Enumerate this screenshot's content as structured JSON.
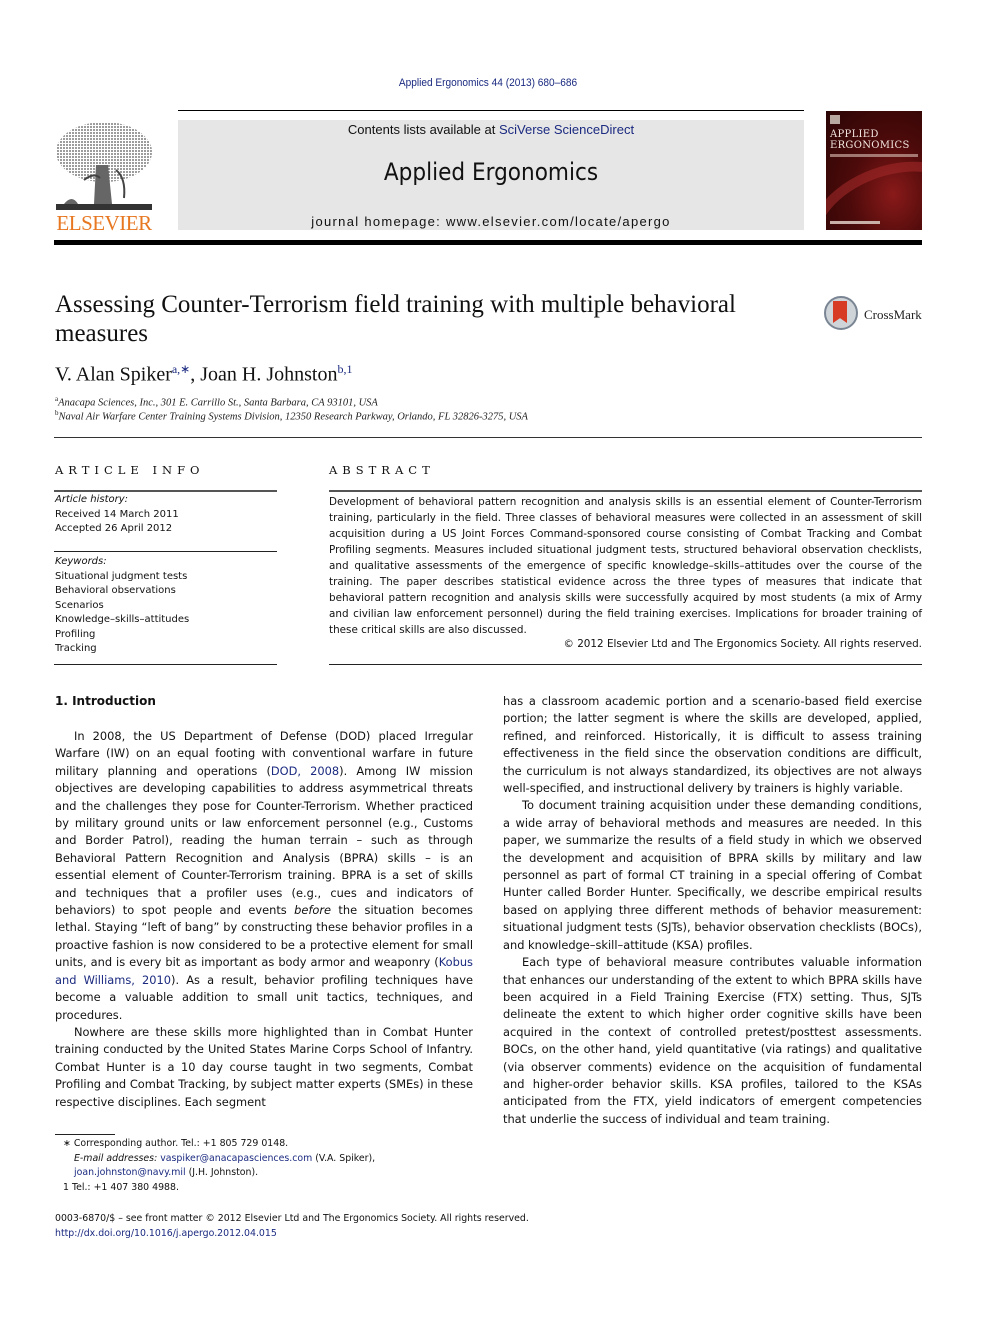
{
  "header": {
    "citation": "Applied Ergonomics 44 (2013) 680–686",
    "contents_prefix": "Contents lists available at ",
    "contents_link": "SciVerse ScienceDirect",
    "journal_title": "Applied Ergonomics",
    "homepage": "journal homepage: www.elsevier.com/locate/apergo",
    "publisher_logo_text": "ELSEVIER",
    "cover": {
      "line1": "APPLIED",
      "line2": "ERGONOMICS"
    },
    "brand_color": "#e87722",
    "link_color": "#1b2a80"
  },
  "crossmark_label": "CrossMark",
  "article": {
    "title": "Assessing Counter-Terrorism field training with multiple behavioral measures",
    "authors": [
      {
        "name": "V. Alan Spiker",
        "sup": "a,∗"
      },
      {
        "name": "Joan H. Johnston",
        "sup": "b,1"
      }
    ],
    "author_separator": ", ",
    "affiliations": [
      {
        "key": "a",
        "text": "Anacapa Sciences, Inc., 301 E. Carrillo St., Santa Barbara, CA 93101, USA"
      },
      {
        "key": "b",
        "text": "Naval Air Warfare Center Training Systems Division, 12350 Research Parkway, Orlando, FL 32826-3275, USA"
      }
    ]
  },
  "article_info": {
    "heading": "ARTICLE INFO",
    "history_label": "Article history:",
    "received": "Received 14 March 2011",
    "accepted": "Accepted 26 April 2012",
    "keywords_label": "Keywords:",
    "keywords": [
      "Situational judgment tests",
      "Behavioral observations",
      "Scenarios",
      "Knowledge–skills–attitudes",
      "Profiling",
      "Tracking"
    ]
  },
  "abstract": {
    "heading": "ABSTRACT",
    "text": "Development of behavioral pattern recognition and analysis skills is an essential element of Counter-Terrorism training, particularly in the field. Three classes of behavioral measures were collected in an assessment of skill acquisition during a US Joint Forces Command-sponsored course consisting of Combat Tracking and Combat Profiling segments. Measures included situational judgment tests, structured behavioral observation checklists, and qualitative assessments of the emergence of specific knowledge–skills–attitudes over the course of the training. The paper describes statistical evidence across the three types of measures that indicate that behavioral pattern recognition and analysis skills were successfully acquired by most students (a mix of Army and civilian law enforcement personnel) during the field training exercises. Implications for broader training of these critical skills are also discussed.",
    "copyright": "© 2012 Elsevier Ltd and The Ergonomics Society. All rights reserved."
  },
  "introduction": {
    "heading": "1.  Introduction",
    "p1": {
      "a": "In 2008, the US Department of Defense (DOD) placed Irregular Warfare (IW) on an equal footing with conventional warfare in future military planning and operations (",
      "ref1": "DOD, 2008",
      "b": "). Among IW mission objectives are developing capabilities to address asymmetrical threats and the challenges they pose for Counter-Terrorism. Whether practiced by military ground units or law enforcement personnel (e.g., Customs and Border Patrol), reading the human terrain – such as through Behavioral Pattern Recognition and Analysis (BPRA) skills – is an essential element of Counter-Terrorism training. BPRA is a set of skills and techniques that a profiler uses (e.g., cues and indicators of behaviors) to spot people and events ",
      "em": "before",
      "c": " the situation becomes lethal. Staying “left of bang” by constructing these behavior profiles in a proactive fashion is now considered to be a protective element for small units, and is every bit as important as body armor and weaponry (",
      "ref2": "Kobus and Williams, 2010",
      "d": "). As a result, behavior profiling techniques have become a valuable addition to small unit tactics, techniques, and procedures."
    },
    "p2": "Nowhere are these skills more highlighted than in Combat Hunter training conducted by the United States Marine Corps School of Infantry. Combat Hunter is a 10 day course taught in two segments, Combat Profiling and Combat Tracking, by subject matter experts (SMEs) in these respective disciplines. Each segment",
    "p2_cont": "has a classroom academic portion and a scenario-based field exercise portion; the latter segment is where the skills are developed, applied, refined, and reinforced. Historically, it is difficult to assess training effectiveness in the field since the observation conditions are difficult, the curriculum is not always standardized, its objectives are not always well-specified, and instructional delivery by trainers is highly variable.",
    "p3": "To document training acquisition under these demanding conditions, a wide array of behavioral methods and measures are needed. In this paper, we summarize the results of a field study in which we observed the development and acquisition of BPRA skills by military and law personnel as part of formal CT training in a special offering of Combat Hunter called Border Hunter. Specifically, we describe empirical results based on applying three different methods of behavior measurement: situational judgment tests (SJTs), behavior observation checklists (BOCs), and knowledge–skill–attitude (KSA) profiles.",
    "p4": "Each type of behavioral measure contributes valuable information that enhances our understanding of the extent to which BPRA skills have been acquired in a Field Training Exercise (FTX) setting. Thus, SJTs delineate the extent to which higher order cognitive skills have been acquired in the context of controlled pretest/posttest assessments. BOCs, on the other hand, yield quantitative (via ratings) and qualitative (via observer comments) evidence on the acquisition of fundamental and higher-order behavior skills. KSA profiles, tailored to the KSAs anticipated from the FTX, yield indicators of emergent competencies that underlie the success of individual and team training."
  },
  "footnotes": {
    "corresponding": "∗  Corresponding author. Tel.: +1 805 729 0148.",
    "email_label": "E-mail addresses:",
    "email1": "vaspiker@anacapasciences.com",
    "email1_owner": " (V.A. Spiker), ",
    "email2": "joan.johnston@navy.mil",
    "email2_owner": " (J.H. Johnston).",
    "fn1": "1  Tel.: +1 407 380 4988."
  },
  "front_matter": {
    "issn_line": "0003-6870/$ – see front matter © 2012 Elsevier Ltd and The Ergonomics Society. All rights reserved.",
    "doi": "http://dx.doi.org/10.1016/j.apergo.2012.04.015"
  }
}
